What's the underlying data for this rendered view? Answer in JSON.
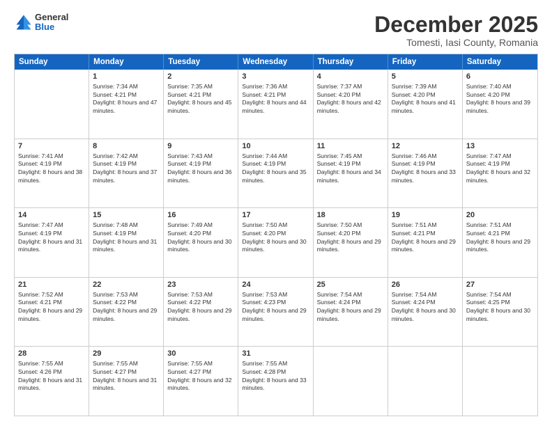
{
  "logo": {
    "general": "General",
    "blue": "Blue"
  },
  "title": "December 2025",
  "location": "Tomesti, Iasi County, Romania",
  "header_days": [
    "Sunday",
    "Monday",
    "Tuesday",
    "Wednesday",
    "Thursday",
    "Friday",
    "Saturday"
  ],
  "weeks": [
    [
      {
        "day": "",
        "sunrise": "",
        "sunset": "",
        "daylight": ""
      },
      {
        "day": "1",
        "sunrise": "Sunrise: 7:34 AM",
        "sunset": "Sunset: 4:21 PM",
        "daylight": "Daylight: 8 hours and 47 minutes."
      },
      {
        "day": "2",
        "sunrise": "Sunrise: 7:35 AM",
        "sunset": "Sunset: 4:21 PM",
        "daylight": "Daylight: 8 hours and 45 minutes."
      },
      {
        "day": "3",
        "sunrise": "Sunrise: 7:36 AM",
        "sunset": "Sunset: 4:21 PM",
        "daylight": "Daylight: 8 hours and 44 minutes."
      },
      {
        "day": "4",
        "sunrise": "Sunrise: 7:37 AM",
        "sunset": "Sunset: 4:20 PM",
        "daylight": "Daylight: 8 hours and 42 minutes."
      },
      {
        "day": "5",
        "sunrise": "Sunrise: 7:39 AM",
        "sunset": "Sunset: 4:20 PM",
        "daylight": "Daylight: 8 hours and 41 minutes."
      },
      {
        "day": "6",
        "sunrise": "Sunrise: 7:40 AM",
        "sunset": "Sunset: 4:20 PM",
        "daylight": "Daylight: 8 hours and 39 minutes."
      }
    ],
    [
      {
        "day": "7",
        "sunrise": "Sunrise: 7:41 AM",
        "sunset": "Sunset: 4:19 PM",
        "daylight": "Daylight: 8 hours and 38 minutes."
      },
      {
        "day": "8",
        "sunrise": "Sunrise: 7:42 AM",
        "sunset": "Sunset: 4:19 PM",
        "daylight": "Daylight: 8 hours and 37 minutes."
      },
      {
        "day": "9",
        "sunrise": "Sunrise: 7:43 AM",
        "sunset": "Sunset: 4:19 PM",
        "daylight": "Daylight: 8 hours and 36 minutes."
      },
      {
        "day": "10",
        "sunrise": "Sunrise: 7:44 AM",
        "sunset": "Sunset: 4:19 PM",
        "daylight": "Daylight: 8 hours and 35 minutes."
      },
      {
        "day": "11",
        "sunrise": "Sunrise: 7:45 AM",
        "sunset": "Sunset: 4:19 PM",
        "daylight": "Daylight: 8 hours and 34 minutes."
      },
      {
        "day": "12",
        "sunrise": "Sunrise: 7:46 AM",
        "sunset": "Sunset: 4:19 PM",
        "daylight": "Daylight: 8 hours and 33 minutes."
      },
      {
        "day": "13",
        "sunrise": "Sunrise: 7:47 AM",
        "sunset": "Sunset: 4:19 PM",
        "daylight": "Daylight: 8 hours and 32 minutes."
      }
    ],
    [
      {
        "day": "14",
        "sunrise": "Sunrise: 7:47 AM",
        "sunset": "Sunset: 4:19 PM",
        "daylight": "Daylight: 8 hours and 31 minutes."
      },
      {
        "day": "15",
        "sunrise": "Sunrise: 7:48 AM",
        "sunset": "Sunset: 4:19 PM",
        "daylight": "Daylight: 8 hours and 31 minutes."
      },
      {
        "day": "16",
        "sunrise": "Sunrise: 7:49 AM",
        "sunset": "Sunset: 4:20 PM",
        "daylight": "Daylight: 8 hours and 30 minutes."
      },
      {
        "day": "17",
        "sunrise": "Sunrise: 7:50 AM",
        "sunset": "Sunset: 4:20 PM",
        "daylight": "Daylight: 8 hours and 30 minutes."
      },
      {
        "day": "18",
        "sunrise": "Sunrise: 7:50 AM",
        "sunset": "Sunset: 4:20 PM",
        "daylight": "Daylight: 8 hours and 29 minutes."
      },
      {
        "day": "19",
        "sunrise": "Sunrise: 7:51 AM",
        "sunset": "Sunset: 4:21 PM",
        "daylight": "Daylight: 8 hours and 29 minutes."
      },
      {
        "day": "20",
        "sunrise": "Sunrise: 7:51 AM",
        "sunset": "Sunset: 4:21 PM",
        "daylight": "Daylight: 8 hours and 29 minutes."
      }
    ],
    [
      {
        "day": "21",
        "sunrise": "Sunrise: 7:52 AM",
        "sunset": "Sunset: 4:21 PM",
        "daylight": "Daylight: 8 hours and 29 minutes."
      },
      {
        "day": "22",
        "sunrise": "Sunrise: 7:53 AM",
        "sunset": "Sunset: 4:22 PM",
        "daylight": "Daylight: 8 hours and 29 minutes."
      },
      {
        "day": "23",
        "sunrise": "Sunrise: 7:53 AM",
        "sunset": "Sunset: 4:22 PM",
        "daylight": "Daylight: 8 hours and 29 minutes."
      },
      {
        "day": "24",
        "sunrise": "Sunrise: 7:53 AM",
        "sunset": "Sunset: 4:23 PM",
        "daylight": "Daylight: 8 hours and 29 minutes."
      },
      {
        "day": "25",
        "sunrise": "Sunrise: 7:54 AM",
        "sunset": "Sunset: 4:24 PM",
        "daylight": "Daylight: 8 hours and 29 minutes."
      },
      {
        "day": "26",
        "sunrise": "Sunrise: 7:54 AM",
        "sunset": "Sunset: 4:24 PM",
        "daylight": "Daylight: 8 hours and 30 minutes."
      },
      {
        "day": "27",
        "sunrise": "Sunrise: 7:54 AM",
        "sunset": "Sunset: 4:25 PM",
        "daylight": "Daylight: 8 hours and 30 minutes."
      }
    ],
    [
      {
        "day": "28",
        "sunrise": "Sunrise: 7:55 AM",
        "sunset": "Sunset: 4:26 PM",
        "daylight": "Daylight: 8 hours and 31 minutes."
      },
      {
        "day": "29",
        "sunrise": "Sunrise: 7:55 AM",
        "sunset": "Sunset: 4:27 PM",
        "daylight": "Daylight: 8 hours and 31 minutes."
      },
      {
        "day": "30",
        "sunrise": "Sunrise: 7:55 AM",
        "sunset": "Sunset: 4:27 PM",
        "daylight": "Daylight: 8 hours and 32 minutes."
      },
      {
        "day": "31",
        "sunrise": "Sunrise: 7:55 AM",
        "sunset": "Sunset: 4:28 PM",
        "daylight": "Daylight: 8 hours and 33 minutes."
      },
      {
        "day": "",
        "sunrise": "",
        "sunset": "",
        "daylight": ""
      },
      {
        "day": "",
        "sunrise": "",
        "sunset": "",
        "daylight": ""
      },
      {
        "day": "",
        "sunrise": "",
        "sunset": "",
        "daylight": ""
      }
    ]
  ]
}
